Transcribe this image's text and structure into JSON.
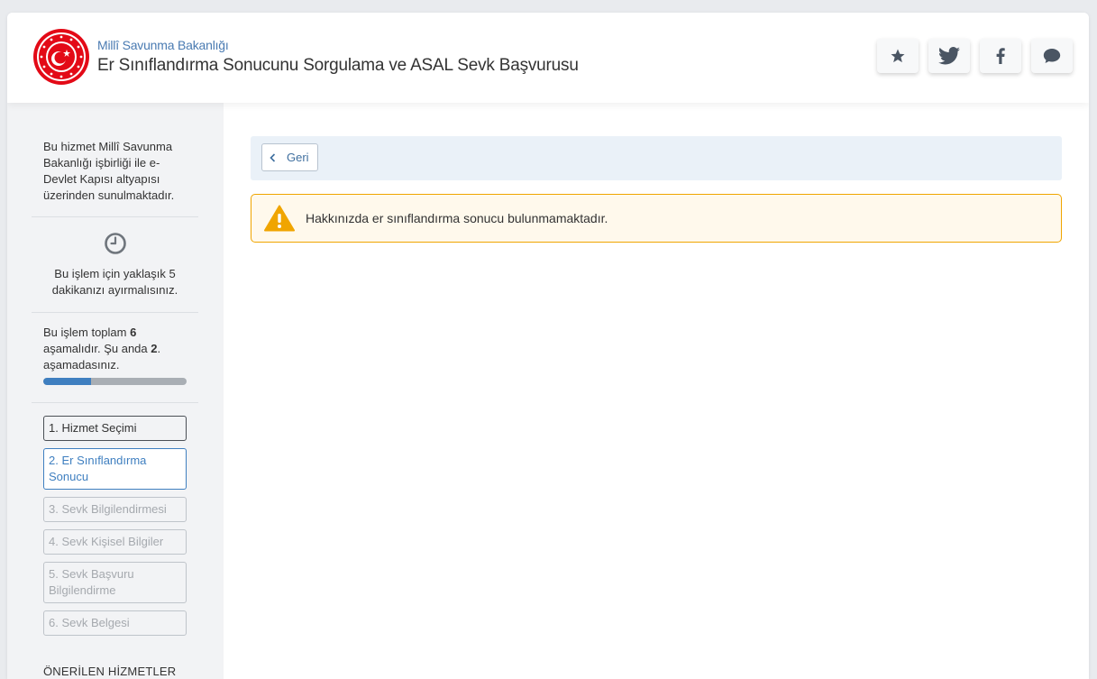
{
  "header": {
    "org_name": "Millî Savunma Bakanlığı",
    "title": "Er Sınıflandırma Sonucunu Sorgulama ve ASAL Sevk Başvurusu",
    "share_buttons": [
      "star-icon",
      "twitter-icon",
      "facebook-icon",
      "comment-icon"
    ]
  },
  "sidebar": {
    "info": "Bu hizmet Millî Savunma Bakanlığı işbirliği ile e-Devlet Kapısı altyapısı üzerinden sunulmaktadır.",
    "time_estimate": "Bu işlem için yaklaşık 5 dakikanızı ayırmalısınız.",
    "progress_prefix": "Bu işlem toplam ",
    "total_steps": "6",
    "progress_mid": " aşamalıdır. Şu anda ",
    "current_step": "2",
    "progress_suffix": ". aşamadasınız.",
    "progress_fraction": 0.3333,
    "steps": [
      {
        "label": "1. Hizmet Seçimi",
        "state": "done"
      },
      {
        "label": "2. Er Sınıflandırma Sonucu",
        "state": "active"
      },
      {
        "label": "3. Sevk Bilgilendirmesi",
        "state": "pending"
      },
      {
        "label": "4. Sevk Kişisel Bilgiler",
        "state": "pending"
      },
      {
        "label": "5. Sevk Başvuru Bilgilendirme",
        "state": "pending"
      },
      {
        "label": "6. Sevk Belgesi",
        "state": "pending"
      }
    ],
    "recommended_heading": "ÖNERİLEN HİZMETLER"
  },
  "main": {
    "back_label": "Geri",
    "alert_message": "Hakkınızda er sınıflandırma sonucu bulunmamaktadır."
  },
  "colors": {
    "accent": "#3f7fc0",
    "warning": "#f0a500",
    "logo_red": "#e30a17"
  }
}
